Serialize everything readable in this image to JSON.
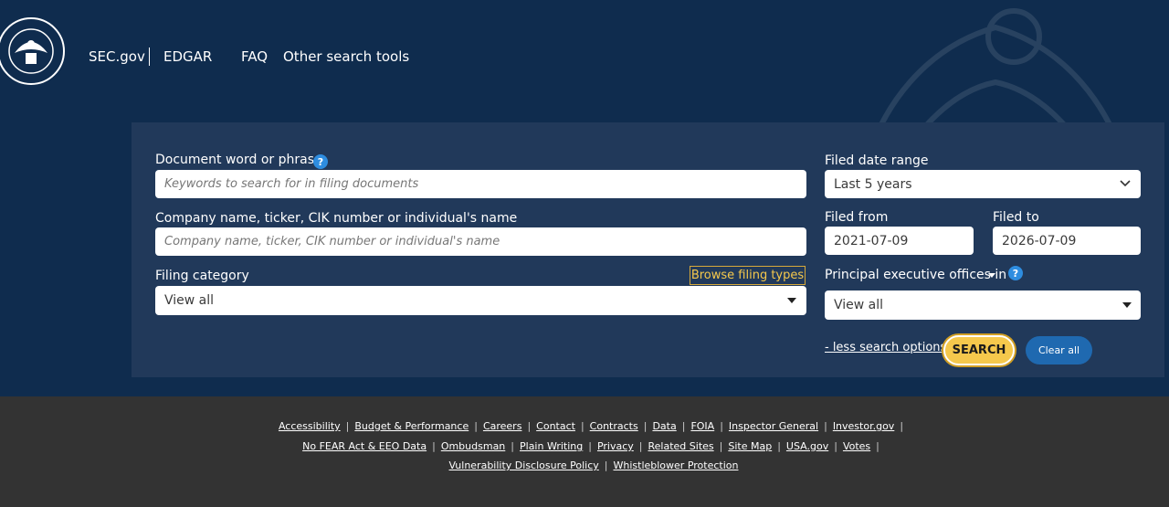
{
  "nav": {
    "sec": "SEC.gov",
    "edgar": "EDGAR",
    "faq": "FAQ",
    "other": "Other search tools"
  },
  "search": {
    "doc_label": "Document word or phrase",
    "doc_placeholder": "Keywords to search for in filing documents",
    "company_label": "Company name, ticker, CIK number or individual's name",
    "company_placeholder": "Company name, ticker, CIK number or individual's name",
    "category_label": "Filing category",
    "category_value": "View all",
    "browse_label": "Browse filing types",
    "date_range_label": "Filed date range",
    "date_range_value": "Last 5 years",
    "filed_from_label": "Filed from",
    "filed_from_value": "2021-07-09",
    "filed_to_label": "Filed to",
    "filed_to_value": "2026-07-09",
    "offices_label": "Principal executive offices in",
    "offices_value": "View all",
    "less_options": "- less search options",
    "search_button": "SEARCH",
    "clear_button": "Clear all",
    "help_glyph": "?"
  },
  "footer": {
    "row1": [
      "Accessibility",
      "Budget & Performance",
      "Careers",
      "Contact",
      "Contracts",
      "Data",
      "FOIA",
      "Inspector General",
      "Investor.gov"
    ],
    "row2": [
      "No FEAR Act & EEO Data",
      "Ombudsman",
      "Plain Writing",
      "Privacy",
      "Related Sites",
      "Site Map",
      "USA.gov",
      "Votes"
    ],
    "row3": [
      "Vulnerability Disclosure Policy",
      "Whistleblower Protection"
    ]
  },
  "colors": {
    "header_bg": "#0f2c4e",
    "panel_bg": "#21395a",
    "footer_bg": "#333333",
    "accent_gold": "#f5c84c",
    "button_blue": "#1f69b0",
    "help_blue": "#2e8de0"
  },
  "icons": [
    "sec-seal-icon",
    "eagle-watermark-icon",
    "help-icon",
    "chevron-down-icon",
    "caret-down-icon"
  ]
}
